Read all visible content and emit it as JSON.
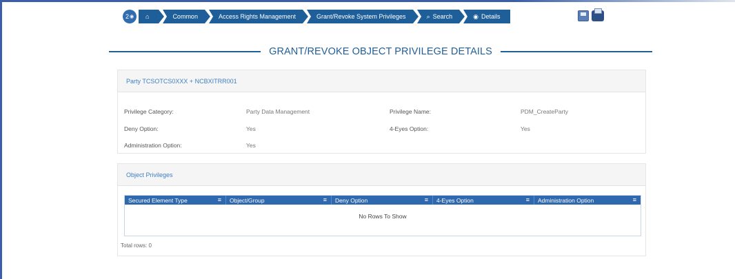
{
  "breadcrumb": {
    "count": "2",
    "items": [
      {
        "label": "Common",
        "icon": "home-icon"
      },
      {
        "label": "Access Rights Management"
      },
      {
        "label": "Grant/Revoke System Privileges"
      },
      {
        "label": "Search",
        "icon": "search-icon"
      },
      {
        "label": "Details",
        "icon": "eye-icon"
      }
    ]
  },
  "toolbar": {
    "save_icon": "save-icon",
    "print_icon": "print-icon"
  },
  "page": {
    "title": "GRANT/REVOKE OBJECT PRIVILEGE DETAILS"
  },
  "party_panel": {
    "header": "Party TCSOTCS0XXX + NCBXITRR001",
    "fields": {
      "privilege_category_label": "Privilege Category:",
      "privilege_category_value": "Party Data Management",
      "privilege_name_label": "Privilege Name:",
      "privilege_name_value": "PDM_CreateParty",
      "deny_option_label": "Deny Option:",
      "deny_option_value": "Yes",
      "four_eyes_label": "4-Eyes Option:",
      "four_eyes_value": "Yes",
      "admin_option_label": "Administration Option:",
      "admin_option_value": "Yes"
    }
  },
  "object_privileges": {
    "header": "Object Privileges",
    "columns": [
      "Secured Element Type",
      "Object/Group",
      "Deny Option",
      "4-Eyes Option",
      "Administration Option"
    ],
    "empty_text": "No Rows To Show",
    "total_rows": "Total rows: 0"
  },
  "colors": {
    "accent": "#1f5f99",
    "grid_header": "#2e68ae"
  }
}
